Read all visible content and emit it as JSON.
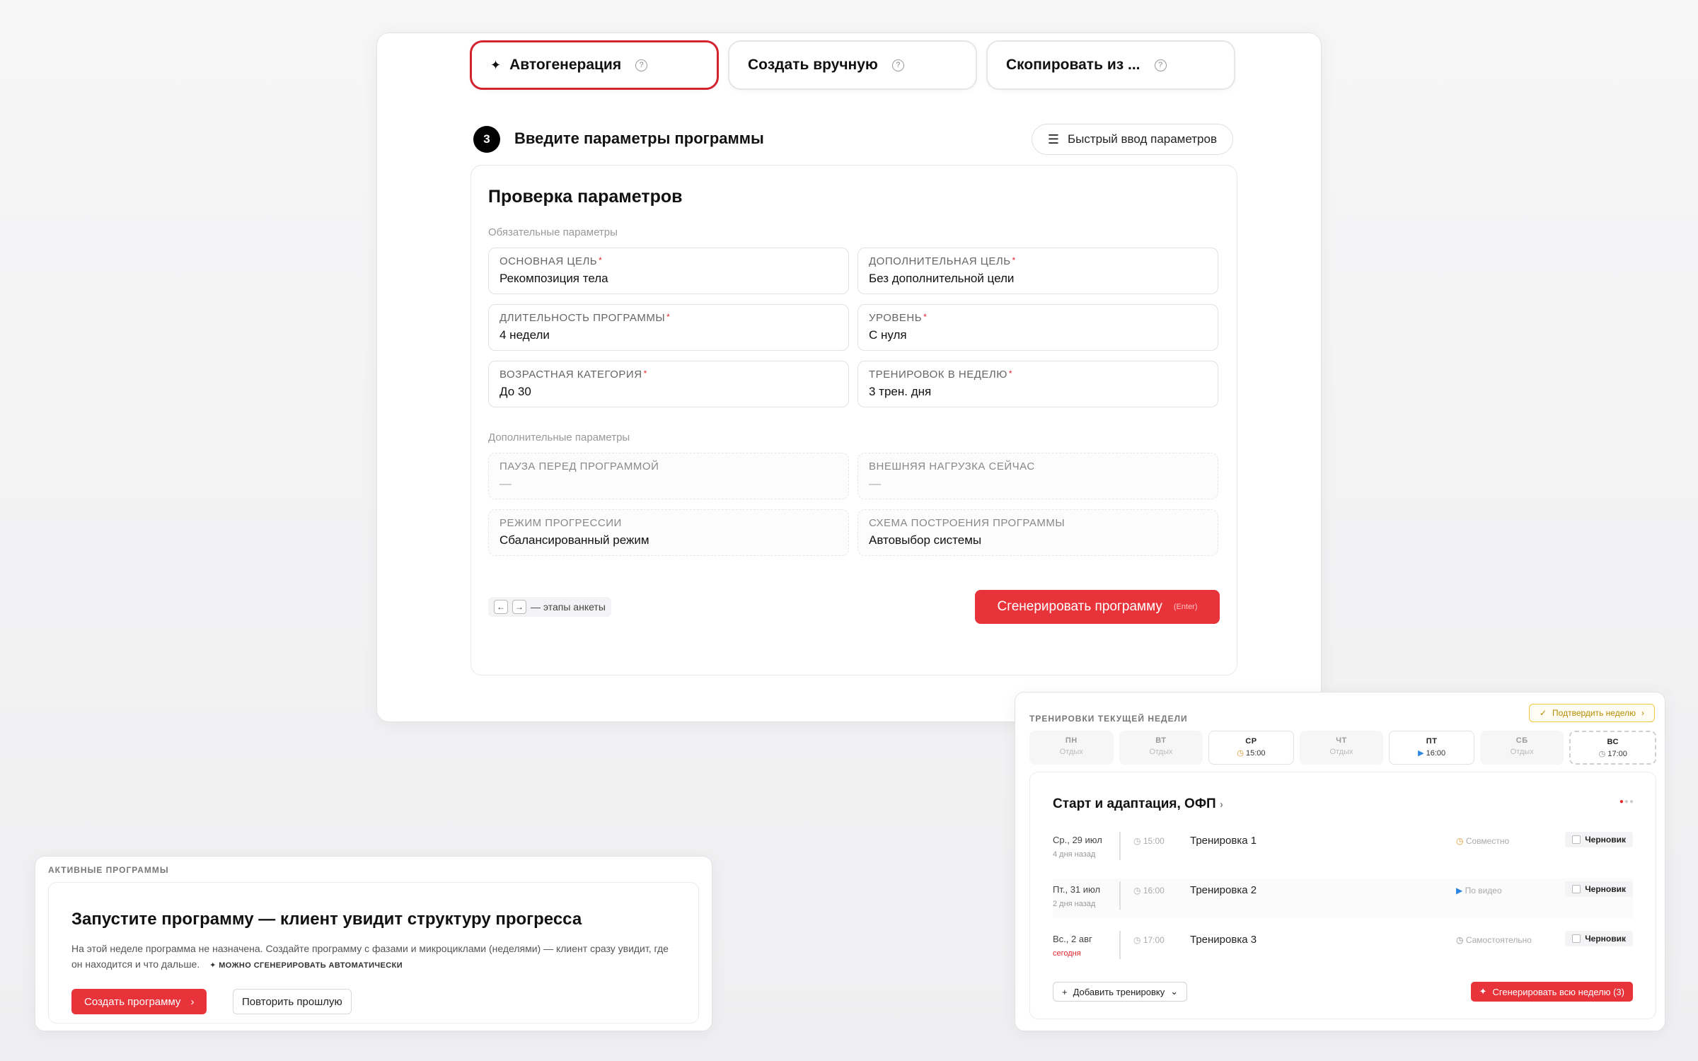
{
  "mode_tabs": [
    {
      "label": "Автогенерация",
      "active": true
    },
    {
      "label": "Создать вручную",
      "active": false
    },
    {
      "label": "Скопировать из ...",
      "active": false
    }
  ],
  "step": {
    "number": "3",
    "title": "Введите параметры программы",
    "quick_input": "Быстрый ввод параметров"
  },
  "params": {
    "title": "Проверка параметров",
    "required_label": "Обязательные параметры",
    "required": [
      {
        "label": "Основная цель",
        "value": "Рекомпозиция тела"
      },
      {
        "label": "Дополнительная цель",
        "value": "Без дополнительной цели"
      },
      {
        "label": "Длительность программы",
        "value": "4 недели"
      },
      {
        "label": "Уровень",
        "value": "С нуля"
      },
      {
        "label": "Возрастная категория",
        "value": "До 30"
      },
      {
        "label": "Тренировок в неделю",
        "value": "3 трен. дня"
      }
    ],
    "optional_label": "Дополнительные параметры",
    "optional": [
      {
        "label": "Пауза перед программой",
        "value": "—"
      },
      {
        "label": "Внешняя нагрузка сейчас",
        "value": "—"
      },
      {
        "label": "Режим прогрессии",
        "value": "Сбалансированный режим"
      },
      {
        "label": "Схема построения программы",
        "value": "Автовыбор системы"
      }
    ],
    "hint": "— этапы анкеты",
    "generate_label": "Сгенерировать программу",
    "generate_shortcut": "(Enter)"
  },
  "active_programs": {
    "caption": "Активные программы",
    "title": "Запустите программу — клиент увидит структуру прогресса",
    "description": "На этой неделе программа не назначена. Создайте программу с фазами и микроциклами (неделями) — клиент сразу увидит, где он находится и что дальше.",
    "auto_note": "МОЖНО СГЕНЕРИРОВАТЬ АВТОМАТИЧЕСКИ",
    "create_label": "Создать программу",
    "repeat_label": "Повторить прошлую"
  },
  "week": {
    "caption": "Тренировки текущей недели",
    "confirm_label": "Подтвердить неделю",
    "days": [
      {
        "name": "ПН",
        "sub": "Отдых"
      },
      {
        "name": "ВТ",
        "sub": "Отдых"
      },
      {
        "name": "СР",
        "sub": "15:00"
      },
      {
        "name": "ЧТ",
        "sub": "Отдых"
      },
      {
        "name": "ПТ",
        "sub": "16:00"
      },
      {
        "name": "СБ",
        "sub": "Отдых"
      },
      {
        "name": "ВС",
        "sub": "17:00"
      }
    ],
    "phase_title": "Старт и адаптация, ОФП",
    "trainings": [
      {
        "date": "Ср., 29 июл",
        "relative": "4 дня назад",
        "time": "15:00",
        "name": "Тренировка 1",
        "mode": "Совместно",
        "status": "Черновик"
      },
      {
        "date": "Пт., 31 июл",
        "relative": "2 дня назад",
        "time": "16:00",
        "name": "Тренировка 2",
        "mode": "По видео",
        "status": "Черновик"
      },
      {
        "date": "Вс., 2 авг",
        "relative": "сегодня",
        "time": "17:00",
        "name": "Тренировка 3",
        "mode": "Самостоятельно",
        "status": "Черновик"
      }
    ],
    "add_label": "Добавить тренировку",
    "generate_week_label": "Сгенерировать всю неделю (3)"
  }
}
